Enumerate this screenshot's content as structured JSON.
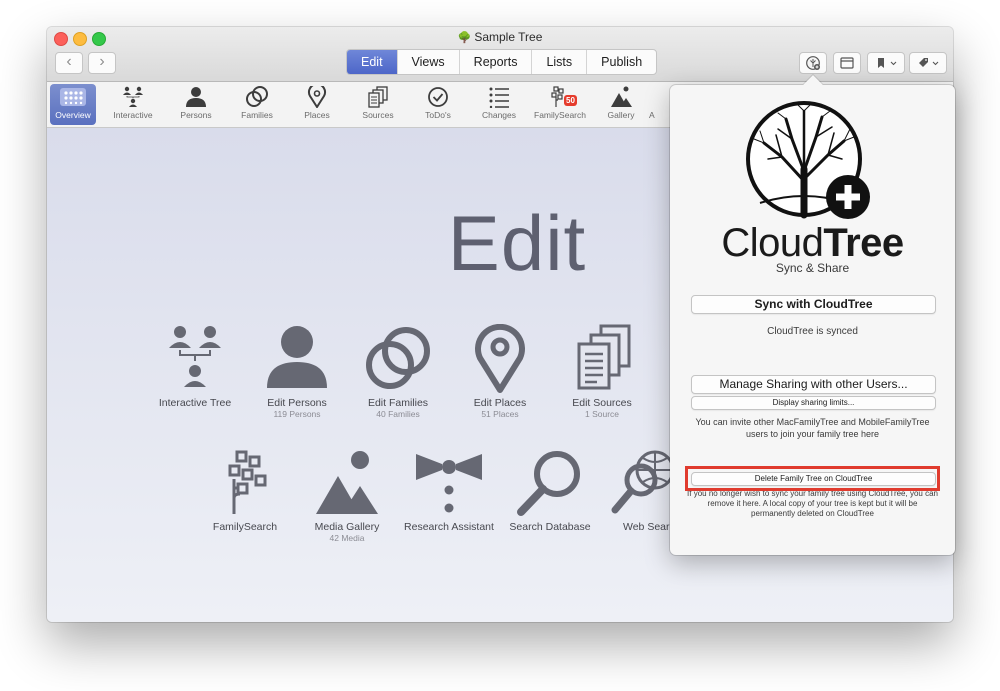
{
  "window": {
    "title": "Sample Tree",
    "nav_back": "‹",
    "nav_forward": "›"
  },
  "tabs": [
    {
      "label": "Edit",
      "active": true
    },
    {
      "label": "Views",
      "active": false
    },
    {
      "label": "Reports",
      "active": false
    },
    {
      "label": "Lists",
      "active": false
    },
    {
      "label": "Publish",
      "active": false
    }
  ],
  "iconbar": {
    "items": [
      {
        "label": "Overview",
        "icon": "grid-icon",
        "active": true
      },
      {
        "label": "Interactive",
        "icon": "interactive-tree-icon"
      },
      {
        "label": "Persons",
        "icon": "person-icon"
      },
      {
        "label": "Families",
        "icon": "rings-icon"
      },
      {
        "label": "Places",
        "icon": "map-pin-icon"
      },
      {
        "label": "Sources",
        "icon": "documents-icon"
      },
      {
        "label": "ToDo's",
        "icon": "checkmark-circle-icon"
      },
      {
        "label": "Changes",
        "icon": "list-icon"
      },
      {
        "label": "FamilySearch",
        "icon": "familysearch-tree-icon",
        "badge": "50"
      },
      {
        "label": "Gallery",
        "icon": "gallery-icon"
      },
      {
        "label": "A",
        "icon": "more-icon"
      }
    ]
  },
  "main": {
    "title": "Edit",
    "tiles": [
      {
        "label": "Interactive Tree",
        "sub": ""
      },
      {
        "label": "Edit Persons",
        "sub": "119 Persons"
      },
      {
        "label": "Edit Families",
        "sub": "40 Families"
      },
      {
        "label": "Edit Places",
        "sub": "51 Places"
      },
      {
        "label": "Edit Sources",
        "sub": "1 Source"
      },
      {
        "label": "FamilySearch",
        "sub": ""
      },
      {
        "label": "Media Gallery",
        "sub": "42 Media"
      },
      {
        "label": "Research Assistant",
        "sub": ""
      },
      {
        "label": "Search Database",
        "sub": ""
      },
      {
        "label": "Web Searc",
        "sub": ""
      }
    ]
  },
  "cloudtree": {
    "brand_light": "Cloud",
    "brand_bold": "Tree",
    "tagline": "Sync & Share",
    "sync_button": "Sync with CloudTree",
    "sync_status": "CloudTree is synced",
    "manage_button": "Manage Sharing with other Users...",
    "display_limits_button": "Display sharing limits...",
    "invite_text": "You can invite other MacFamilyTree and MobileFamilyTree users to join your family tree here",
    "delete_button": "Delete Family Tree on CloudTree",
    "delete_text": "If you no longer wish to sync your family tree using CloudTree, you can remove it here. A local copy of your tree is kept but it will be permanently deleted on CloudTree"
  },
  "colors": {
    "accent": "#5a70bf",
    "highlight": "#e03b2e",
    "icon_gray": "#666873"
  }
}
